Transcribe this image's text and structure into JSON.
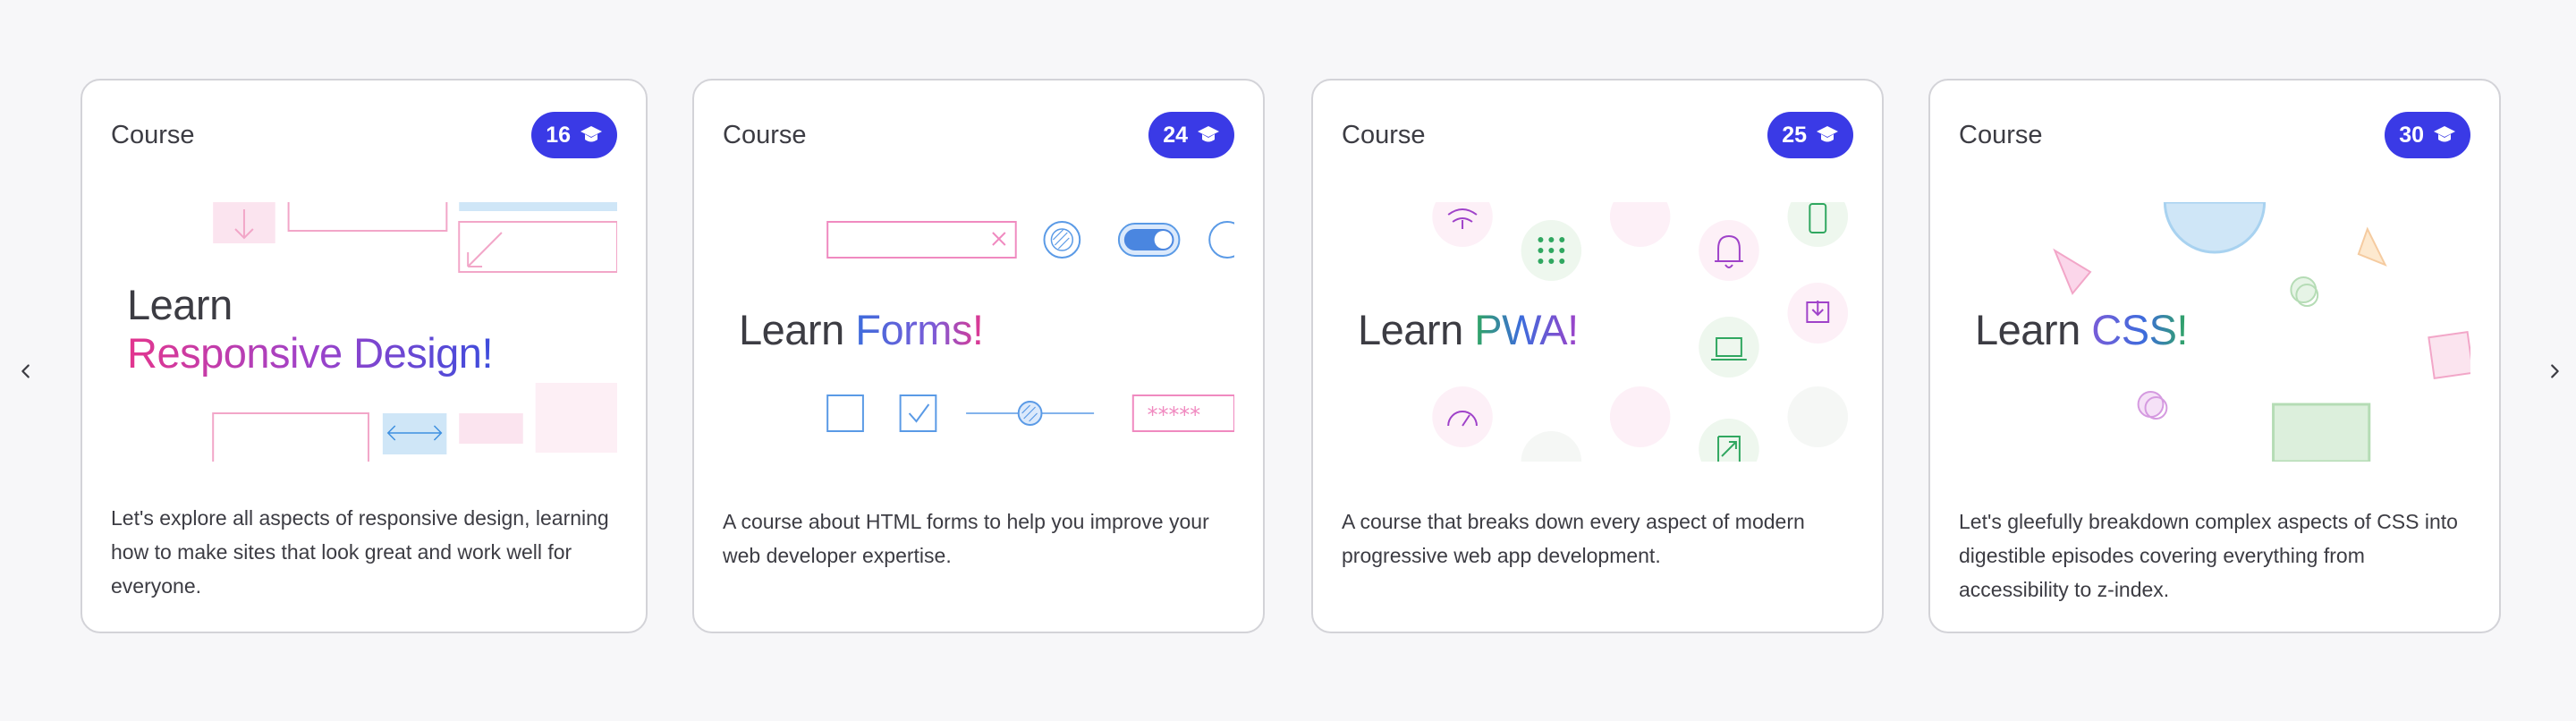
{
  "carousel": {
    "prev_icon": "chevron-left-icon",
    "next_icon": "chevron-right-icon",
    "badge_icon": "graduation-cap-icon",
    "accent_color": "#3a3ae6",
    "cards": [
      {
        "type": "Course",
        "count": "16",
        "title_plain": "Learn",
        "title_accent": "Responsive Design!",
        "description": "Let's explore all aspects of responsive design, learning how to make sites that look great and work well for everyone."
      },
      {
        "type": "Course",
        "count": "24",
        "title_plain": "Learn",
        "title_accent": "Forms!",
        "description": "A course about HTML forms to help you improve your web developer expertise."
      },
      {
        "type": "Course",
        "count": "25",
        "title_plain": "Learn",
        "title_accent": "PWA!",
        "description": "A course that breaks down every aspect of modern progressive web app development."
      },
      {
        "type": "Course",
        "count": "30",
        "title_plain": "Learn",
        "title_accent": "CSS!",
        "description": "Let's gleefully breakdown complex aspects of CSS into digestible episodes covering everything from accessibility to z-index."
      }
    ]
  }
}
